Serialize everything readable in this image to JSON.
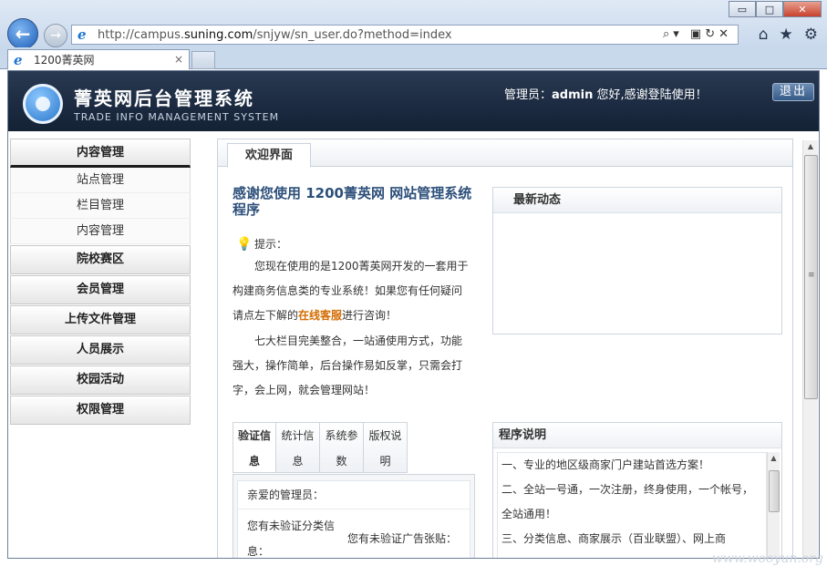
{
  "browser": {
    "url_prefix": "http://campus.",
    "url_domain": "suning.com",
    "url_rest": "/snjyw/sn_user.do?method=index",
    "tab_title": "1200菁英网",
    "win_min": "▭",
    "win_max": "□",
    "win_close": "✕",
    "back": "←",
    "forward": "→",
    "addr_tools": "⌕▾ ▣↻✕",
    "tab_close": "×",
    "icons": [
      "home-icon",
      "star-icon",
      "gear-icon"
    ]
  },
  "header": {
    "title": "菁英网后台管理系统",
    "subtitle": "TRADE INFO MANAGEMENT SYSTEM",
    "admin_prefix": "管理员：",
    "admin_name": "admin",
    "admin_suffix": " 您好,感谢登陆使用！",
    "logout": "退出"
  },
  "sidebar": {
    "groups": [
      {
        "label": "内容管理",
        "items": [
          "站点管理",
          "栏目管理",
          "内容管理"
        ]
      },
      {
        "label": "院校赛区"
      },
      {
        "label": "会员管理"
      },
      {
        "label": "上传文件管理"
      },
      {
        "label": "人员展示"
      },
      {
        "label": "校园活动"
      },
      {
        "label": "权限管理"
      }
    ]
  },
  "main": {
    "tab": "欢迎界面",
    "welcome_title": "感谢您使用 1200菁英网 网站管理系统程序",
    "tip_label": "提示：",
    "para1_a": "您现在使用的是1200菁英网开发的一套用于构建商务信息类的专业系统！如果您有任何疑问请点左下解的",
    "para1_link": "在线客服",
    "para1_b": "进行咨询！",
    "para2": "七大栏目完美整合，一站通使用方式，功能强大，操作简单，后台操作易如反掌，只需会打字，会上网，就会管理网站！",
    "news_title": "最新动态",
    "verify_tabs": [
      "验证信息",
      "统计信息",
      "系统参数",
      "版权说明"
    ],
    "verify_greeting": "亲爱的管理员：",
    "verify_col1": "您有未验证分类信息：",
    "verify_col2": "您有未验证广告张贴：",
    "prog_title": "程序说明",
    "prog_items": [
      "一、专业的地区级商家门户建站首选方案！",
      "二、全站一号通，一次注册，终身使用，一个帐号，全站通用！",
      "三、分类信息、商家展示（百业联盟）、网上商"
    ]
  },
  "watermark": "www.wooyun.org"
}
